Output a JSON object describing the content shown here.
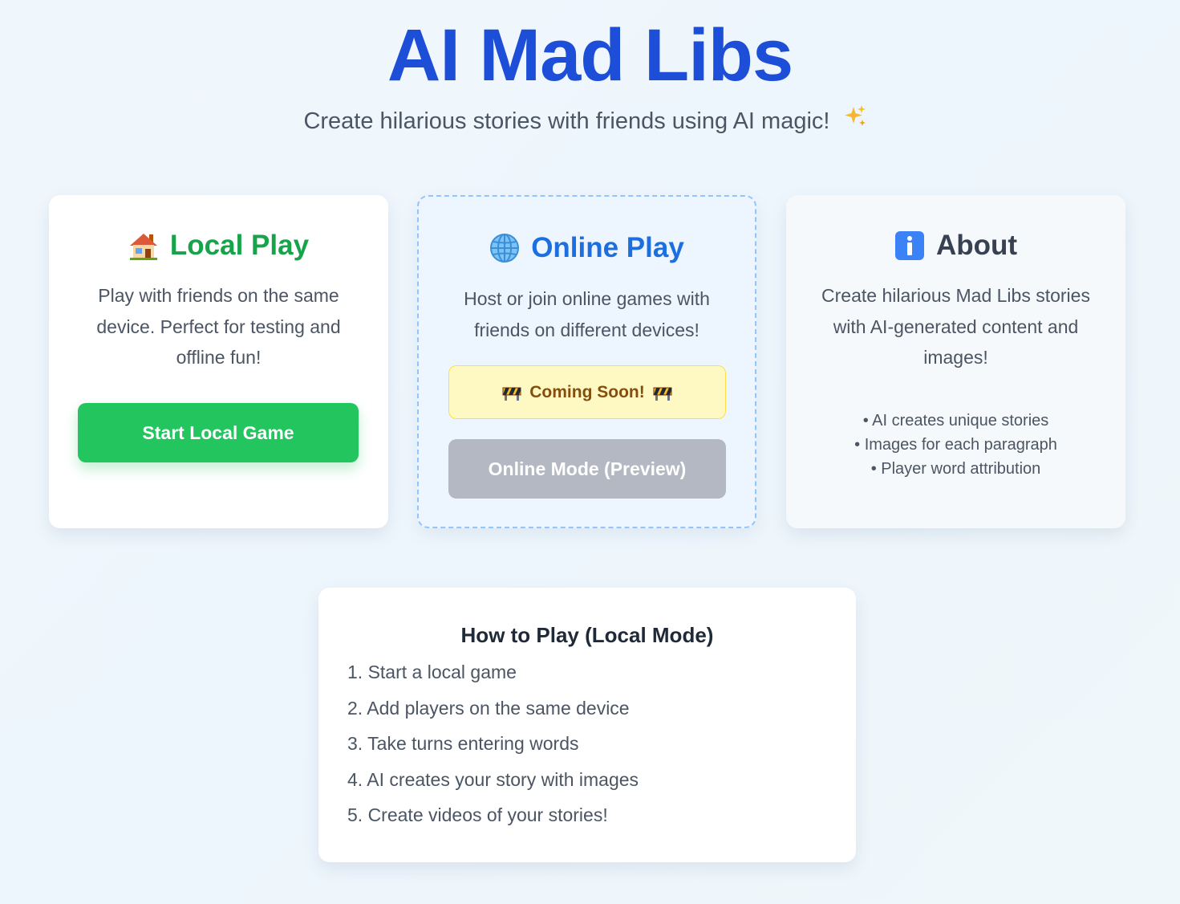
{
  "header": {
    "title": "AI Mad Libs",
    "subtitle": "Create hilarious stories with friends using AI magic!",
    "subtitle_icon": "sparkles-icon"
  },
  "local_card": {
    "icon": "house-icon",
    "title": "Local Play",
    "description": "Play with friends on the same device. Perfect for testing and offline fun!",
    "button_label": "Start Local Game",
    "color": "#16a34a",
    "button_color": "#22c55e"
  },
  "online_card": {
    "icon": "globe-icon",
    "title": "Online Play",
    "description": "Host or join online games with friends on different devices!",
    "notice": "Coming Soon!",
    "notice_icon": "construction-barrier-icon",
    "button_label": "Online Mode (Preview)",
    "color": "#1d6fe0"
  },
  "about_card": {
    "icon": "info-icon",
    "title": "About",
    "description": "Create hilarious Mad Libs stories with AI-generated content and images!",
    "features": [
      "• AI creates unique stories",
      "• Images for each paragraph",
      "• Player word attribution"
    ]
  },
  "how_to": {
    "title": "How to Play (Local Mode)",
    "steps": [
      "1. Start a local game",
      "2. Add players on the same device",
      "3. Take turns entering words",
      "4. AI creates your story with images",
      "5. Create videos of your stories!"
    ]
  },
  "colors": {
    "title": "#1d4ed8",
    "accent_green": "#22c55e",
    "accent_blue": "#93c5fd",
    "notice_bg": "#fef9c3"
  }
}
